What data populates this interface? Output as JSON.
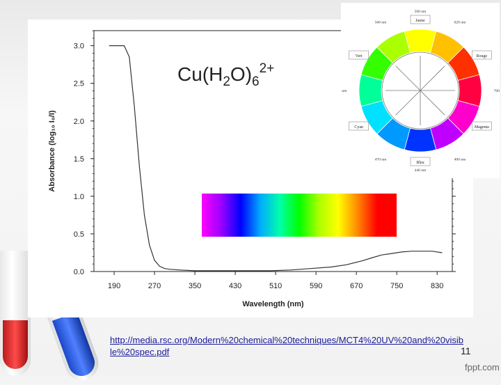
{
  "slide": {
    "formula": {
      "base": "Cu(H",
      "sub1": "2",
      "mid": "O)",
      "sub2": "6",
      "sup": "2+"
    },
    "link": "http://media.rsc.org/Modern%20chemical%20techniques/MCT4%20UV%20and%20visible%20spec.pdf",
    "slide_number": "11",
    "watermark": "fppt.com"
  },
  "chart_data": {
    "type": "line",
    "xlabel": "Wavelength (nm)",
    "ylabel": "Absorbance (log₁₀ I₀/I)",
    "xlim": [
      150,
      860
    ],
    "ylim": [
      0,
      3.2
    ],
    "x_ticks": [
      190,
      270,
      350,
      430,
      510,
      590,
      670,
      750,
      830
    ],
    "y_ticks": [
      0.0,
      0.5,
      1.0,
      1.5,
      2.0,
      2.5,
      3.0
    ],
    "y_tick_labels": [
      "0.0",
      "0.5",
      "1.0",
      "1.5",
      "2.0",
      "2.5",
      "3.0"
    ],
    "series": [
      {
        "color": "#333333",
        "x": [
          180,
          200,
          210,
          220,
          230,
          240,
          250,
          260,
          270,
          280,
          290,
          300,
          320,
          350,
          400,
          450,
          500,
          540,
          580,
          620,
          650,
          680,
          700,
          720,
          740,
          760,
          780,
          800,
          820,
          840
        ],
        "y": [
          3.0,
          3.0,
          3.0,
          2.85,
          2.2,
          1.4,
          0.75,
          0.35,
          0.15,
          0.07,
          0.04,
          0.03,
          0.02,
          0.01,
          0.01,
          0.01,
          0.01,
          0.02,
          0.04,
          0.06,
          0.09,
          0.14,
          0.18,
          0.22,
          0.24,
          0.26,
          0.27,
          0.27,
          0.27,
          0.25
        ]
      }
    ],
    "spectrum_colors": [
      "#ff00ff",
      "#9b00ff",
      "#0000ff",
      "#00aaff",
      "#00ffaa",
      "#00ff00",
      "#aaff00",
      "#ffff00",
      "#ff8800",
      "#ff0000",
      "#ff0000"
    ]
  },
  "color_wheel": {
    "segments": [
      {
        "name": "Jaune",
        "color": "#ffff00"
      },
      {
        "name": "",
        "color": "#ffc000"
      },
      {
        "name": "Rouge",
        "color": "#ff3000"
      },
      {
        "name": "",
        "color": "#ff0040"
      },
      {
        "name": "Magenta",
        "color": "#ff00cc"
      },
      {
        "name": "",
        "color": "#c000ff"
      },
      {
        "name": "Bleu",
        "color": "#0033ff"
      },
      {
        "name": "",
        "color": "#0099ff"
      },
      {
        "name": "Cyan",
        "color": "#00e0ff"
      },
      {
        "name": "",
        "color": "#00ff99"
      },
      {
        "name": "Vert",
        "color": "#33ff00"
      },
      {
        "name": "",
        "color": "#aaff00"
      }
    ],
    "wavelength_labels": [
      "590 nm",
      "620 nm",
      "700 nm",
      "400 nm",
      "440 nm",
      "470 nm",
      "500 nm",
      "560 nm"
    ]
  }
}
